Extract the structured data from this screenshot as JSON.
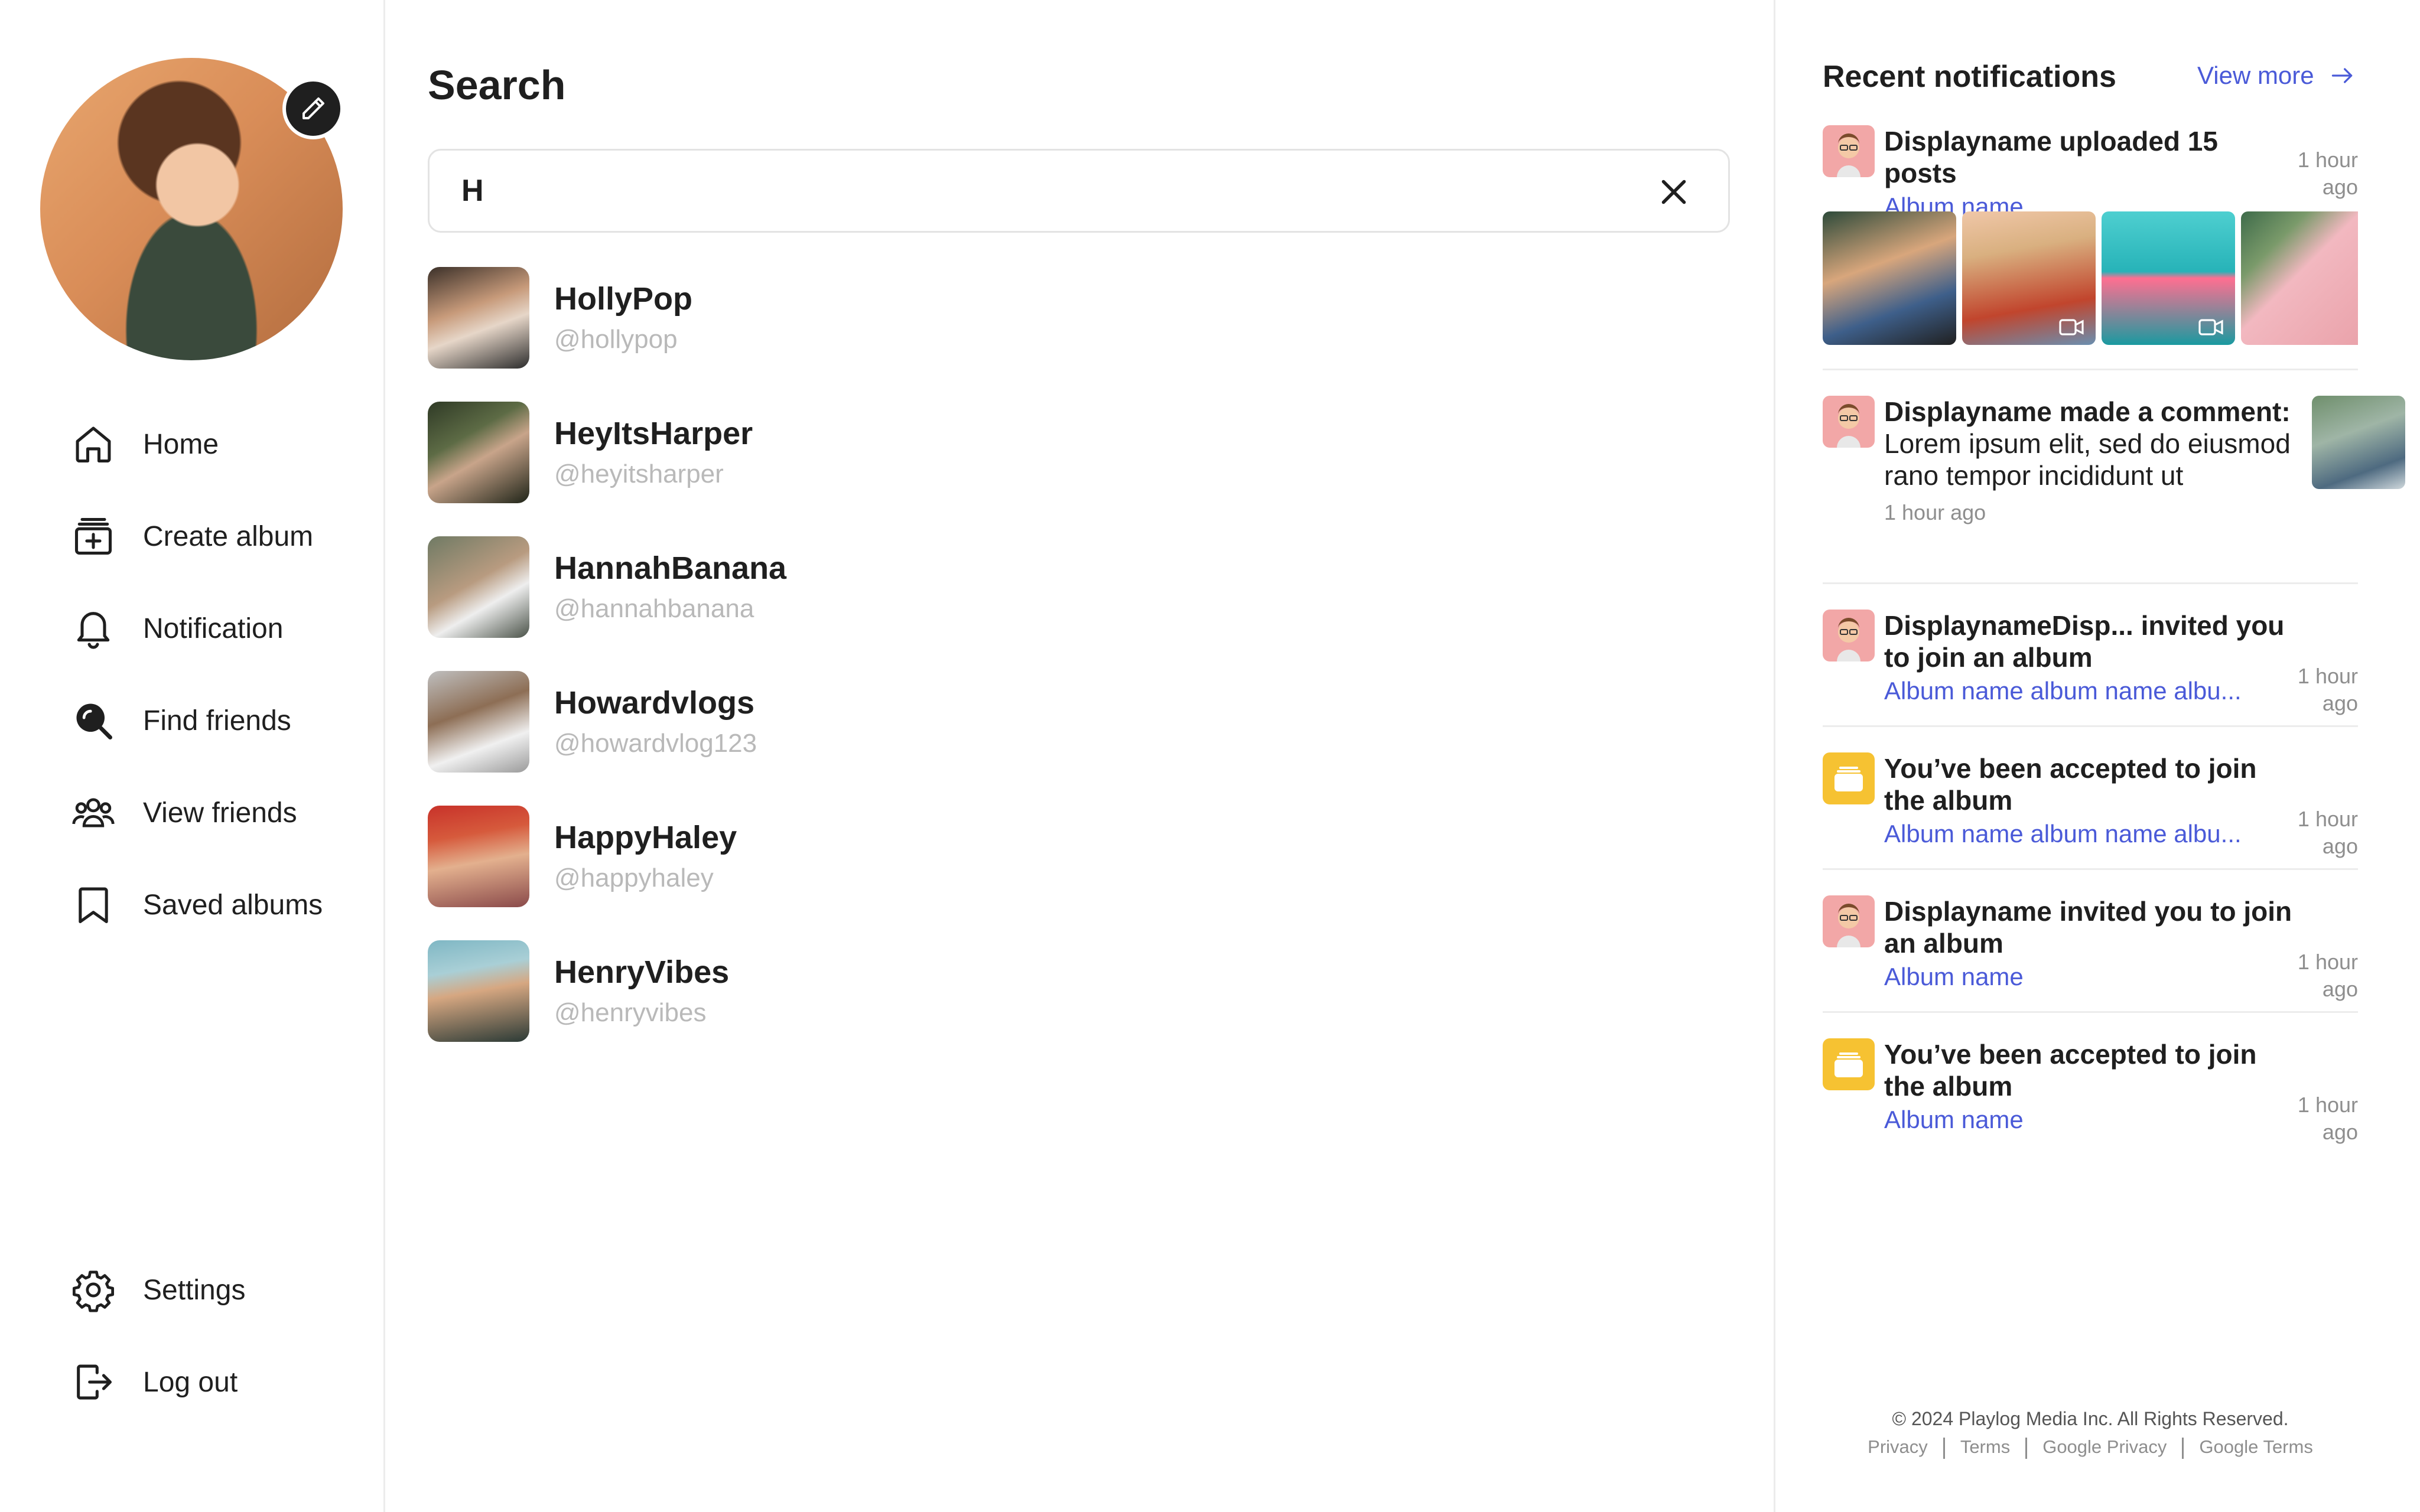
{
  "sidebar": {
    "nav": [
      {
        "label": "Home",
        "icon": "home-icon"
      },
      {
        "label": "Create album",
        "icon": "create-album-icon"
      },
      {
        "label": "Notification",
        "icon": "bell-icon"
      },
      {
        "label": "Find friends",
        "icon": "search-icon"
      },
      {
        "label": "View friends",
        "icon": "friends-icon"
      },
      {
        "label": "Saved albums",
        "icon": "bookmark-icon"
      }
    ],
    "bottom": [
      {
        "label": "Settings",
        "icon": "gear-icon"
      },
      {
        "label": "Log out",
        "icon": "logout-icon"
      }
    ]
  },
  "search": {
    "title": "Search",
    "value": "H",
    "results": [
      {
        "name": "HollyPop",
        "handle": "@hollypop"
      },
      {
        "name": "HeyItsHarper",
        "handle": "@heyitsharper"
      },
      {
        "name": "HannahBanana",
        "handle": "@hannahbanana"
      },
      {
        "name": "Howardvlogs",
        "handle": "@howardvlog123"
      },
      {
        "name": "HappyHaley",
        "handle": "@happyhaley"
      },
      {
        "name": "HenryVibes",
        "handle": "@henryvibes"
      }
    ]
  },
  "notifications": {
    "title": "Recent notifications",
    "view_more": "View more",
    "items": [
      {
        "title": "Displayname uploaded 15 posts",
        "sub": "Album name",
        "time_1": "1 hour",
        "time_2": "ago"
      },
      {
        "title_bold": "Displayname made a comment:",
        "title_rest": " Lorem ipsum elit, sed do eiusmod rano tempor incididunt ut",
        "time": "1 hour ago"
      },
      {
        "title": "DisplaynameDisp... invited you to join an album",
        "sub": "Album name album name albu...",
        "time_1": "1 hour",
        "time_2": "ago"
      },
      {
        "title": "You’ve been accepted to join the album",
        "sub": "Album name album name albu...",
        "time_1": "1 hour",
        "time_2": "ago"
      },
      {
        "title": "Displayname invited you to join an album",
        "sub": "Album name",
        "time_1": "1 hour",
        "time_2": "ago"
      },
      {
        "title": "You’ve been accepted to join the album",
        "sub": "Album name",
        "time_1": "1 hour",
        "time_2": "ago"
      }
    ]
  },
  "footer": {
    "copyright": "© 2024 Playlog Media Inc. All Rights Reserved.",
    "links": [
      "Privacy",
      "Terms",
      "Google Privacy",
      "Google Terms"
    ]
  },
  "colors": {
    "accent": "#4a5ad8",
    "album_icon": "#f6c232",
    "text": "#1f1f1f",
    "muted": "#b9b9b9"
  }
}
